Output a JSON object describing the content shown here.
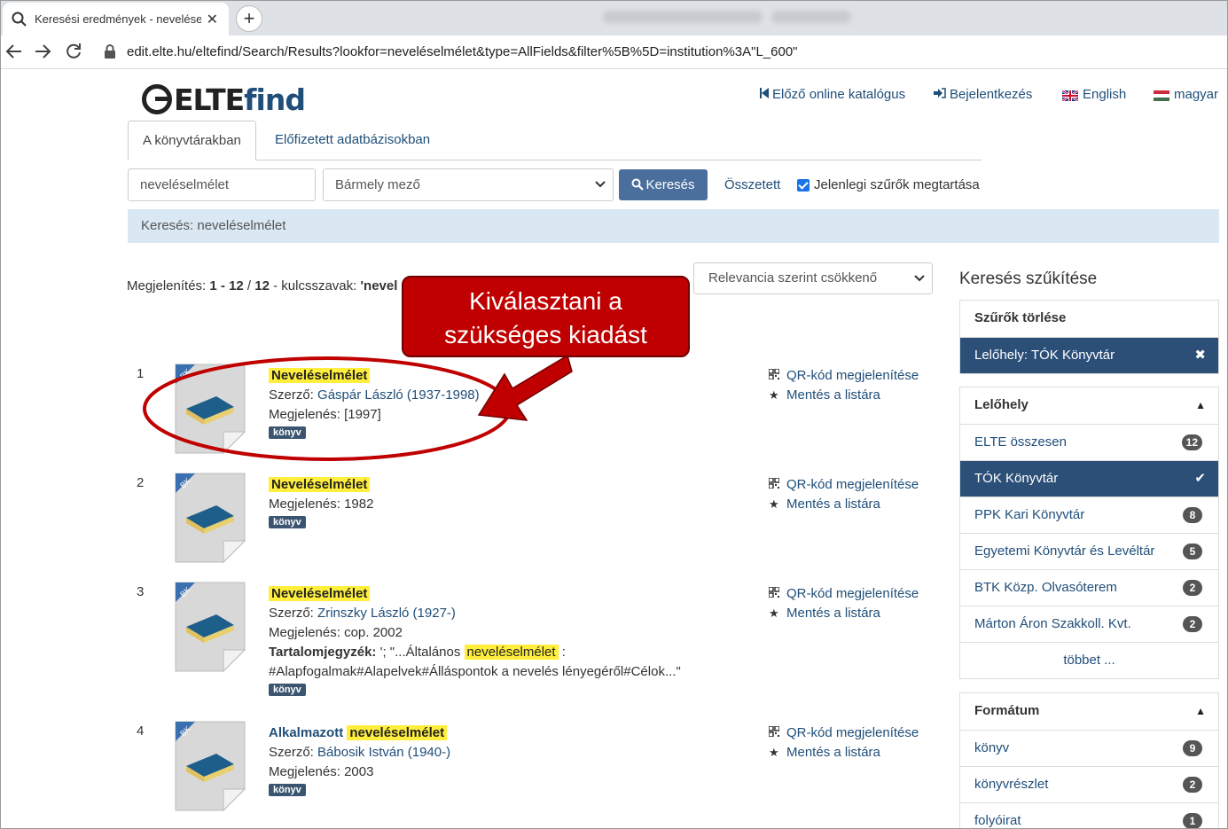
{
  "browser": {
    "tab_title": "Keresési eredmények - neveléselméle",
    "tab_close": "✕",
    "new_tab": "+",
    "url": "edit.elte.hu/eltefind/Search/Results?lookfor=neveléselmélet&type=AllFields&filter%5B%5D=institution%3A\"L_600\""
  },
  "header": {
    "logo_elte": "ELTE",
    "logo_find": "find",
    "nav": {
      "prev_catalog": "Előző online katalógus",
      "login": "Bejelentkezés",
      "english": "English",
      "hungarian": "magyar"
    }
  },
  "tabs": {
    "libraries": "A könyvtárakban",
    "databases": "Előfizetett adatbázisokban"
  },
  "search": {
    "query": "neveléselmélet",
    "field_select": "Bármely mező",
    "button": "Keresés",
    "advanced": "Összetett",
    "keep_filters": "Jelenlegi szűrők megtartása"
  },
  "breadcrumb": "Keresés: neveléselmélet",
  "results_header": {
    "prefix": "Megjelenítés: ",
    "range": "1 - 12",
    "sep": " / ",
    "total": "12",
    "kw_label": " - kulcsszavak: ",
    "kw": "'nevel",
    "sort": "Relevancia szerint csökkenő"
  },
  "results": [
    {
      "num": "1",
      "title": "Neveléselmélet",
      "author_label": "Szerző: ",
      "author": "Gáspár László (1937-1998)",
      "pub_label": "Megjelenés: ",
      "pub": "[1997]",
      "format": "könyv"
    },
    {
      "num": "2",
      "title": "Neveléselmélet",
      "pub_label": "Megjelenés: ",
      "pub": "1982",
      "format": "könyv"
    },
    {
      "num": "3",
      "title": "Neveléselmélet",
      "author_label": "Szerző: ",
      "author": "Zrinszky László (1927-)",
      "pub_label": "Megjelenés: ",
      "pub": "cop. 2002",
      "toc_label": "Tartalomjegyzék: ",
      "toc_pre": "'; \"...Általános ",
      "toc_hl": "neveléselmélet",
      "toc_post": " :",
      "toc_line2": "#Alapfogalmak#Alapelvek#Álláspontok a nevelés lényegéről#Célok...\"",
      "format": "könyv"
    },
    {
      "num": "4",
      "title_pre": "Alkalmazott",
      "title": "neveléselmélet",
      "author_label": "Szerző: ",
      "author": "Bábosik István (1940-)",
      "pub_label": "Megjelenés: ",
      "pub": "2003",
      "format": "könyv"
    }
  ],
  "result_actions": {
    "qr": "QR-kód megjelenítése",
    "save": "Mentés a listára"
  },
  "cover_label": "BK",
  "sidebar": {
    "heading": "Keresés szűkítése",
    "clear_filters": "Szűrők törlése",
    "active_filter": "Lelőhely: TÓK Könyvtár",
    "location_heading": "Lelőhely",
    "locations": [
      {
        "label": "ELTE összesen",
        "count": "12"
      },
      {
        "label": "TÓK Könyvtár",
        "count": ""
      },
      {
        "label": "PPK Kari Könyvtár",
        "count": "8"
      },
      {
        "label": "Egyetemi Könyvtár és Levéltár",
        "count": "5"
      },
      {
        "label": "BTK Közp. Olvasóterem",
        "count": "2"
      },
      {
        "label": "Márton Áron Szakkoll. Kvt.",
        "count": "2"
      }
    ],
    "more": "többet ...",
    "format_heading": "Formátum",
    "formats": [
      {
        "label": "könyv",
        "count": "9"
      },
      {
        "label": "könyvrészlet",
        "count": "2"
      },
      {
        "label": "folyóirat",
        "count": "1"
      }
    ]
  },
  "annotation": {
    "line1": "Kiválasztani a",
    "line2": "szükséges kiadást"
  },
  "colors": {
    "link": "#1f4e79",
    "active_filter_bg": "#2c4f78",
    "highlight": "#ffef3c",
    "callout": "#c00000",
    "search_button": "#4a6f9c"
  }
}
